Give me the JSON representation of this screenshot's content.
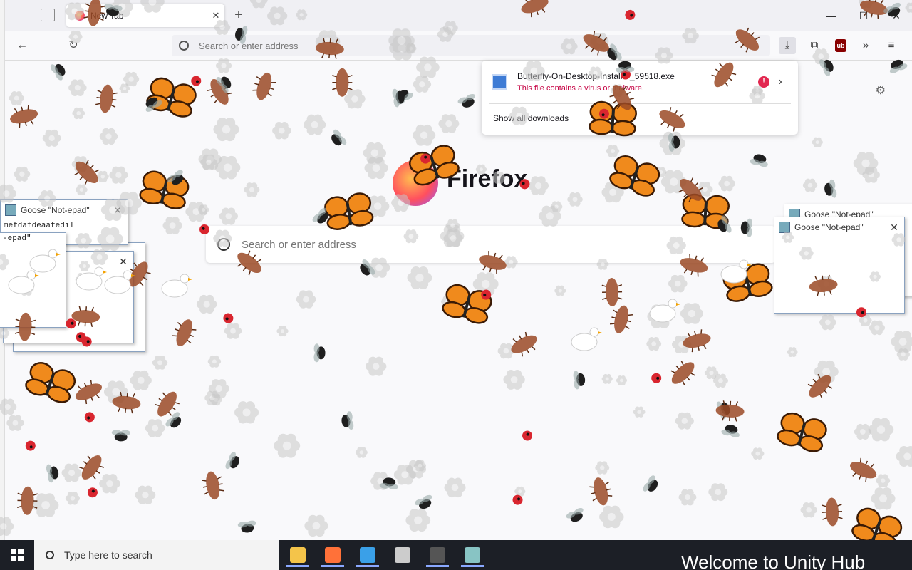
{
  "browser": {
    "tab_title": "New Tab",
    "tab_close": "✕",
    "new_tab": "+",
    "window_controls": {
      "minimize": "—",
      "maximize": "☐",
      "close": "✕"
    },
    "nav": {
      "back": "←",
      "reload": "↻"
    },
    "urlbar_placeholder": "Search or enter address",
    "toolbar": {
      "download": "⤓",
      "extensions": "⧉",
      "ublock": "ub",
      "overflow": "»",
      "menu": "≡"
    }
  },
  "newtab": {
    "settings_icon": "⚙",
    "wordmark": "Firefox",
    "search_placeholder": "Search or enter address"
  },
  "downloads_panel": {
    "filename": "Butterfly-On-Desktop-Installer_59518.exe",
    "status": "This file contains a virus or malware.",
    "warning": "!",
    "arrow": "›",
    "show_all": "Show all downloads"
  },
  "goose_windows": [
    {
      "title": "Goose \"Not-epad\"",
      "text": "mefdafdeaafedil",
      "close": "✕"
    },
    {
      "title": "",
      "text": "-epad\"",
      "close": ""
    },
    {
      "title": "",
      "text": "-epad\"",
      "close": "✕"
    },
    {
      "title": "Goose \"Not-epad\"",
      "text": "",
      "close": ""
    },
    {
      "title": "Goose \"Not-epad\"",
      "text": "",
      "close": "✕"
    }
  ],
  "taskbar": {
    "search_placeholder": "Type here to search",
    "apps": [
      {
        "name": "file-explorer",
        "color": "#f4c44a",
        "active": true
      },
      {
        "name": "firefox",
        "color": "#ff7139",
        "active": true
      },
      {
        "name": "app-blue",
        "color": "#3aa0e8",
        "active": true
      },
      {
        "name": "unity-hub",
        "color": "#cccccc",
        "active": false
      },
      {
        "name": "7zip",
        "color": "#555555",
        "active": true
      },
      {
        "name": "notepad",
        "color": "#88c4c4",
        "active": true
      }
    ],
    "notification_text": "Welcome to Unity Hub"
  }
}
